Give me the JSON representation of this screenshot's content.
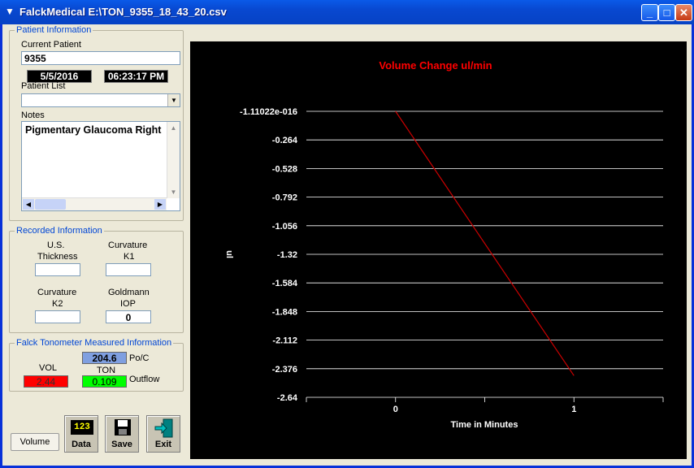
{
  "window": {
    "title": "FalckMedical E:\\TON_9355_18_43_20.csv"
  },
  "patient": {
    "group_label": "Patient Information",
    "current_label": "Current Patient",
    "current_value": "9355",
    "date": "5/5/2016",
    "time": "06:23:17 PM",
    "list_label": "Patient List",
    "list_value": "",
    "notes_label": "Notes",
    "notes_value": "Pigmentary Glaucoma Right"
  },
  "recorded": {
    "group_label": "Recorded Information",
    "us_label_1": "U.S.",
    "us_label_2": "Thickness",
    "us_value": "",
    "k1_label_1": "Curvature",
    "k1_label_2": "K1",
    "k1_value": "",
    "k2_label_1": "Curvature",
    "k2_label_2": "K2",
    "k2_value": "",
    "iop_label_1": "Goldmann",
    "iop_label_2": "IOP",
    "iop_value": "0"
  },
  "falck": {
    "group_label": "Falck Tonometer Measured Information",
    "poc_value": "204.6",
    "poc_label": "Po/C",
    "vol_label": "VOL",
    "vol_value": "2.44",
    "ton_label": "TON",
    "outflow_value": "0.109",
    "outflow_label": "Outflow",
    "colors": {
      "poc": "#7f9fe0",
      "vol": "#ff0000",
      "outflow": "#00ff00"
    }
  },
  "toolbar": {
    "volume_label": "Volume",
    "data_label": "Data",
    "data_icon_text": "123",
    "save_label": "Save",
    "exit_label": "Exit"
  },
  "chart_data": {
    "type": "line",
    "title": "Volume Change ul/min",
    "xlabel": "Time in Minutes",
    "ylabel": "ul",
    "x_ticks": [
      "0",
      "1"
    ],
    "y_ticks": [
      "-1.11022e-016",
      "-0.264",
      "-0.528",
      "-0.792",
      "-1.056",
      "-1.32",
      "-1.584",
      "-1.848",
      "-2.112",
      "-2.376",
      "-2.64"
    ],
    "xlim": [
      -0.5,
      1.5
    ],
    "ylim": [
      -2.64,
      0
    ],
    "series": [
      {
        "x": [
          0,
          1
        ],
        "y": [
          0,
          -2.44
        ],
        "color": "#cc0000"
      }
    ],
    "grid": true,
    "colors": {
      "background": "#000000",
      "title": "#ff0000",
      "text": "#ffffff",
      "grid": "#ffffff"
    }
  }
}
